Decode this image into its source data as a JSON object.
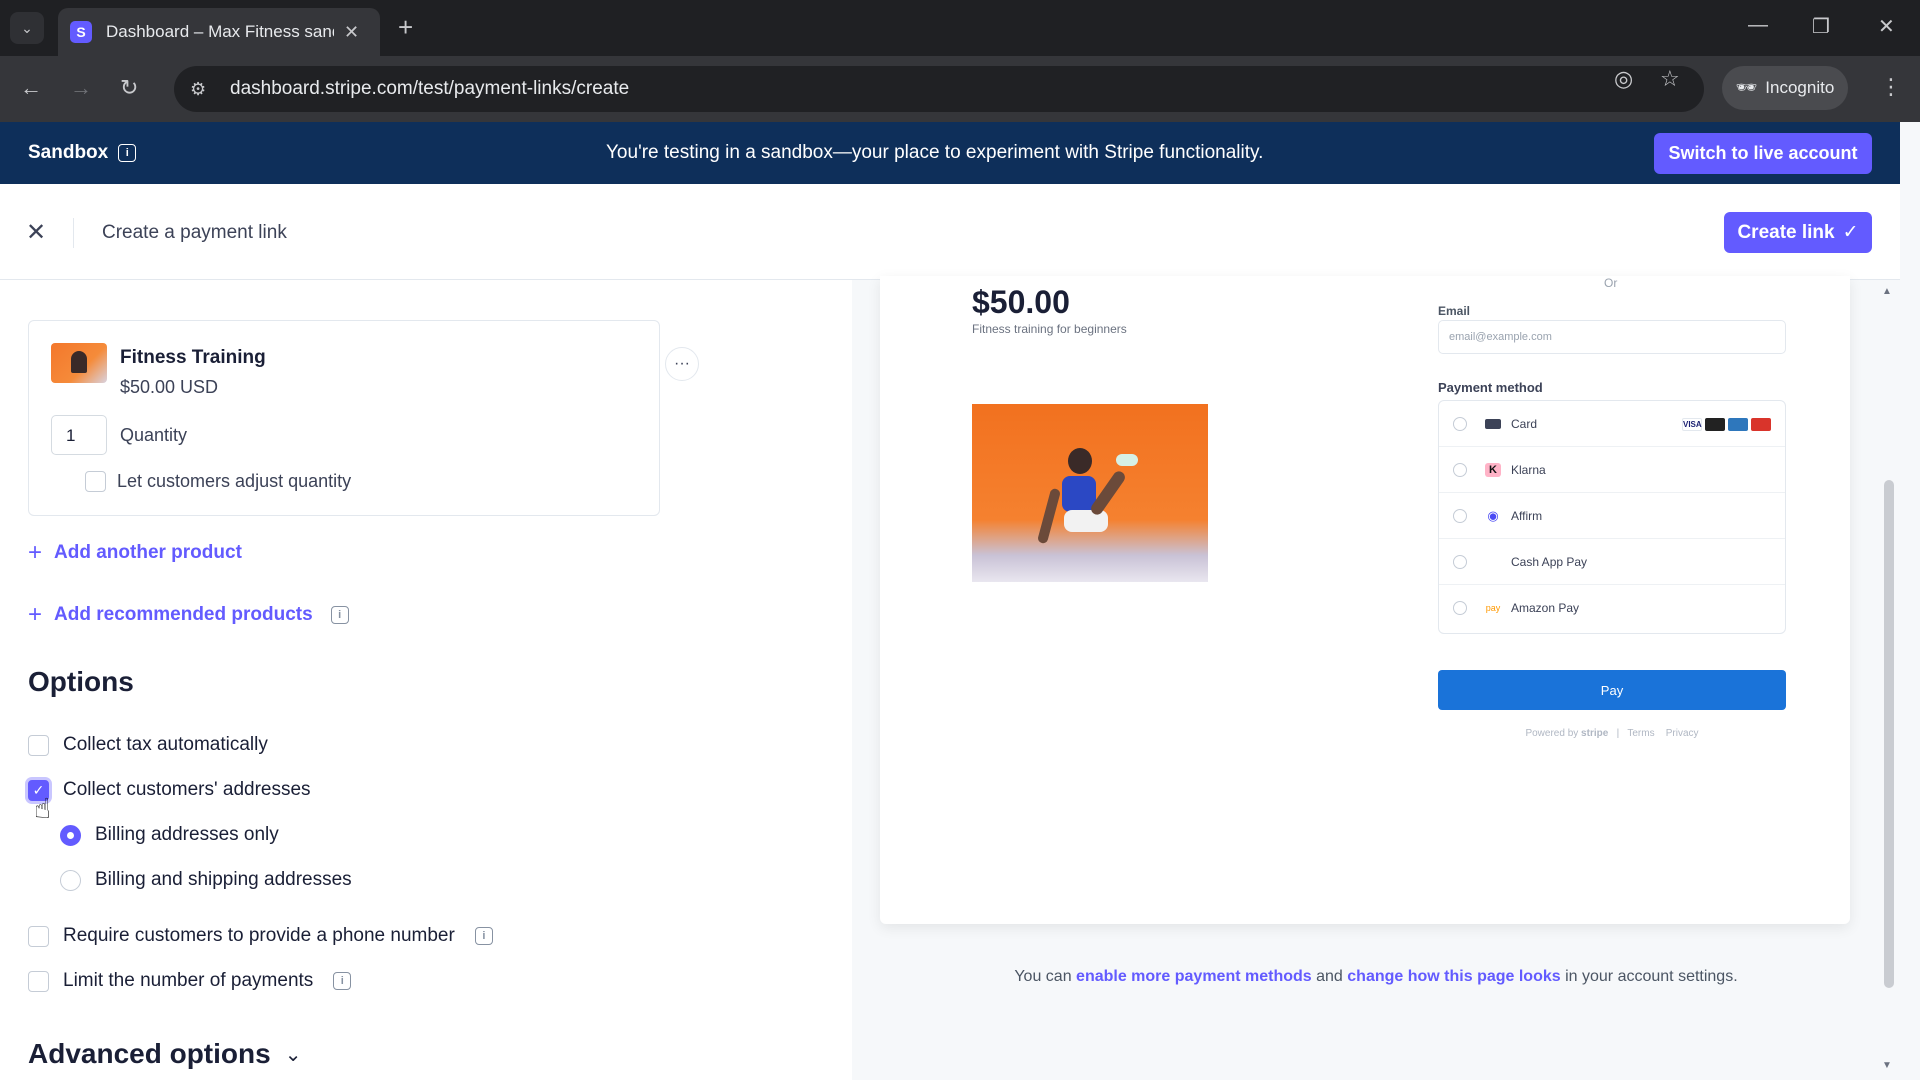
{
  "browser": {
    "tab_title": "Dashboard – Max Fitness sandb",
    "favicon_letter": "S",
    "url": "dashboard.stripe.com/test/payment-links/create",
    "incognito_label": "Incognito"
  },
  "banner": {
    "label": "Sandbox",
    "message": "You're testing in a sandbox—your place to experiment with Stripe functionality.",
    "switch_button": "Switch to live account"
  },
  "header": {
    "title": "Create a payment link",
    "create_button": "Create link"
  },
  "product": {
    "name": "Fitness Training",
    "price": "$50.00 USD",
    "quantity": "1",
    "quantity_label": "Quantity",
    "adjust_label": "Let customers adjust quantity"
  },
  "links": {
    "add_another": "Add another product",
    "add_recommended": "Add recommended products"
  },
  "options": {
    "title": "Options",
    "collect_tax": "Collect tax automatically",
    "collect_addresses": "Collect customers' addresses",
    "billing_only": "Billing addresses only",
    "billing_shipping": "Billing and shipping addresses",
    "require_phone": "Require customers to provide a phone number",
    "limit_payments": "Limit the number of payments",
    "advanced": "Advanced options"
  },
  "preview": {
    "price": "$50.00",
    "description": "Fitness training for beginners",
    "or": "Or",
    "email_label": "Email",
    "email_placeholder": "email@example.com",
    "payment_method_label": "Payment method",
    "methods": [
      "Card",
      "Klarna",
      "Affirm",
      "Cash App Pay",
      "Amazon Pay"
    ],
    "pay_button": "Pay",
    "powered_by": "Powered by",
    "stripe": "stripe",
    "terms": "Terms",
    "privacy": "Privacy"
  },
  "note": {
    "prefix": "You can",
    "link1": "enable more payment methods",
    "middle": "and",
    "link2": "change how this page looks",
    "suffix": "in your account settings."
  },
  "colors": {
    "accent": "#635bff",
    "banner_bg": "#0e2f5a",
    "pay_button": "#1a73d9"
  }
}
